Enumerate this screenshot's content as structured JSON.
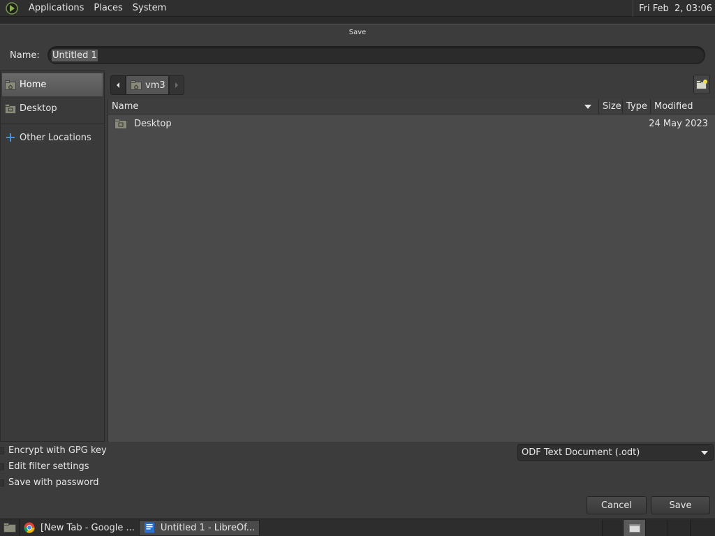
{
  "top_panel": {
    "menus": [
      "Applications",
      "Places",
      "System"
    ],
    "clock": "Fri Feb  2, 03:06"
  },
  "dialog": {
    "title": "Save",
    "name_label": "Name:",
    "name_value": "Untitled 1",
    "sidebar": [
      {
        "label": "Home",
        "icon": "home-folder-icon",
        "active": true
      },
      {
        "label": "Desktop",
        "icon": "desktop-folder-icon",
        "active": false
      },
      {
        "label": "Other Locations",
        "icon": "plus-icon",
        "active": false
      }
    ],
    "path": {
      "current": "vm3"
    },
    "columns": {
      "name": "Name",
      "size": "Size",
      "type": "Type",
      "modified": "Modified"
    },
    "files": [
      {
        "name": "Desktop",
        "size": "",
        "type": "",
        "modified": "24 May 2023"
      }
    ],
    "options": {
      "encrypt": "Encrypt with GPG key",
      "edit_filter": "Edit filter settings",
      "password": "Save with password"
    },
    "filter_value": "ODF Text Document (.odt)",
    "buttons": {
      "cancel": "Cancel",
      "save": "Save"
    }
  },
  "taskbar": {
    "tasks": [
      {
        "label": "[New Tab - Google ...",
        "active": false
      },
      {
        "label": "Untitled 1 - LibreOf...",
        "active": true
      }
    ]
  },
  "colors": {
    "background": "#3c3c3c",
    "panel": "#2f2f2f",
    "list": "#4a4a4a",
    "selection": "#5a5a5a"
  }
}
